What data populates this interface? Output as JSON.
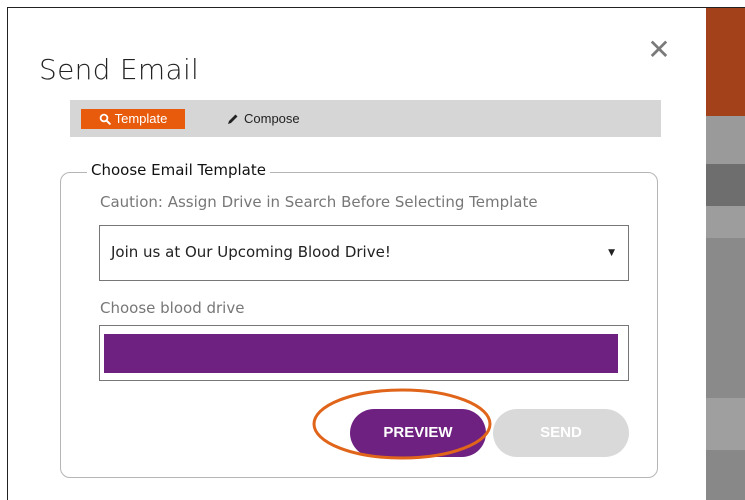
{
  "modal": {
    "title": "Send Email",
    "close_icon": "close-icon"
  },
  "tabs": [
    {
      "label": "Template",
      "icon": "search-icon",
      "active": true
    },
    {
      "label": "Compose",
      "icon": "pencil-icon",
      "active": false
    }
  ],
  "template_section": {
    "legend": "Choose Email Template",
    "caution": "Caution: Assign Drive in Search Before Selecting Template",
    "selected_template": "Join us at Our Upcoming Blood Drive!"
  },
  "drive_section": {
    "label": "Choose blood drive"
  },
  "actions": {
    "preview_label": "PREVIEW",
    "send_label": "SEND"
  },
  "colors": {
    "accent_orange": "#e85a0c",
    "brand_purple": "#6e2180",
    "disabled_gray": "#d9d9d9",
    "annotation_ring": "#e0651a"
  }
}
